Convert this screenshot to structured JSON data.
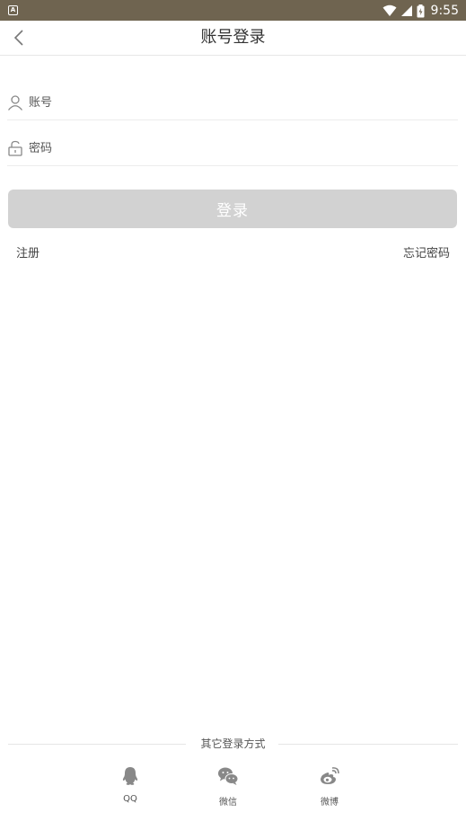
{
  "status_bar": {
    "notification_letter": "A",
    "time": "9:55"
  },
  "header": {
    "title": "账号登录",
    "back_icon": "chevron-left-icon"
  },
  "form": {
    "account_placeholder": "账号",
    "password_placeholder": "密码",
    "login_label": "登录",
    "login_button_color": "#d2d2d2"
  },
  "links": {
    "register": "注册",
    "forgot_password": "忘记密码"
  },
  "other_login": {
    "label": "其它登录方式",
    "providers": [
      {
        "label": "QQ",
        "icon": "qq-icon"
      },
      {
        "label": "微信",
        "icon": "wechat-icon"
      },
      {
        "label": "微博",
        "icon": "weibo-icon"
      }
    ]
  }
}
